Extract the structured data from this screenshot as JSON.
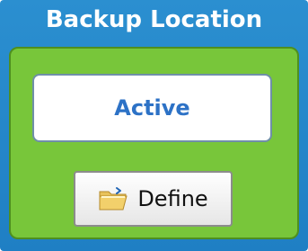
{
  "panel": {
    "title": "Backup Location",
    "status": "Active",
    "define_button": {
      "label": "Define",
      "icon": "folder-open-icon"
    }
  },
  "colors": {
    "header_blue": "#2b8fd0",
    "panel_green": "#78c63a",
    "status_text_blue": "#2d72c6"
  }
}
